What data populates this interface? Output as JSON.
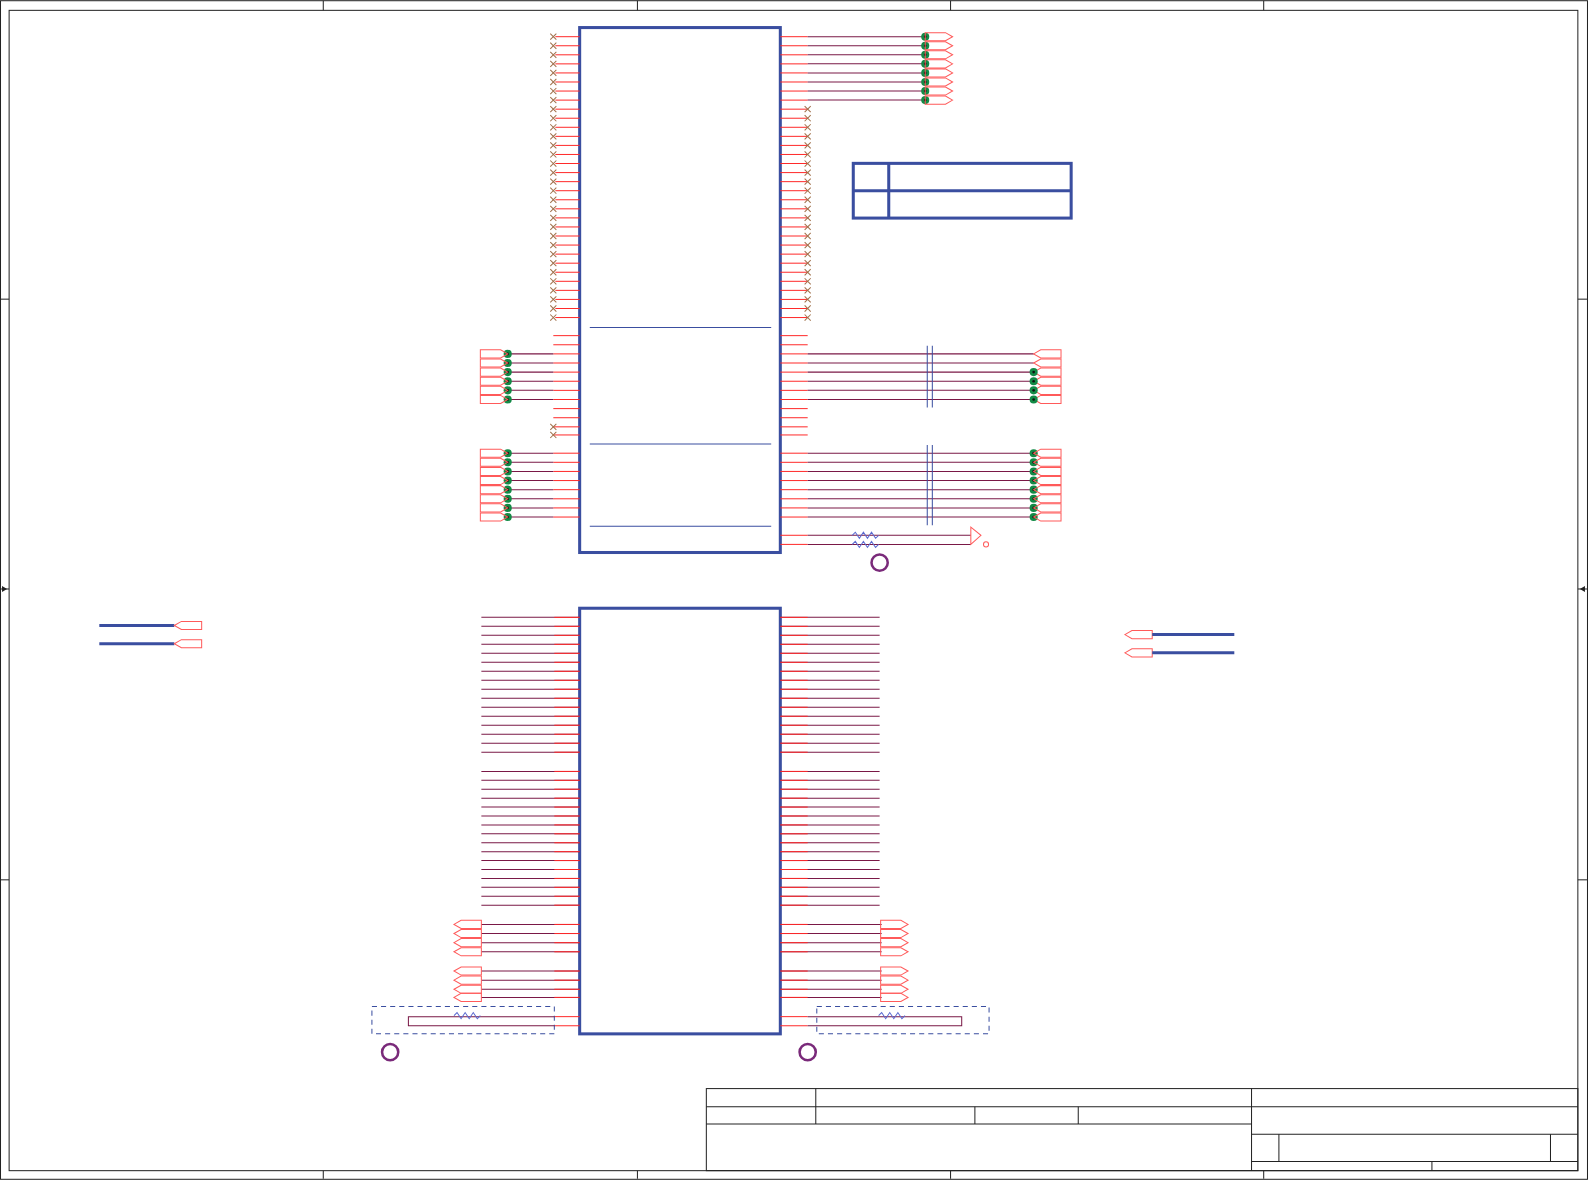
{
  "sheet": {
    "kind": "schematic"
  }
}
